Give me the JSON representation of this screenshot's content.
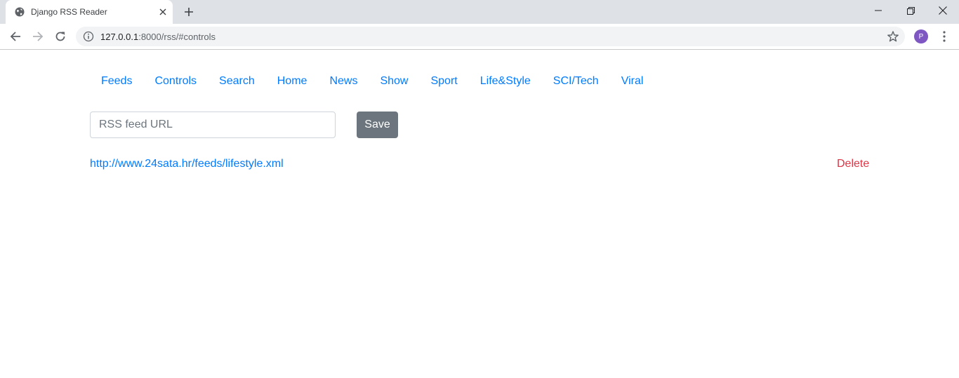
{
  "browser": {
    "tab_title": "Django RSS Reader",
    "url_host": "127.0.0.1",
    "url_path": ":8000/rss/#controls",
    "profile_initial": "P"
  },
  "nav": {
    "items": [
      {
        "label": "Feeds"
      },
      {
        "label": "Controls"
      },
      {
        "label": "Search"
      },
      {
        "label": "Home"
      },
      {
        "label": "News"
      },
      {
        "label": "Show"
      },
      {
        "label": "Sport"
      },
      {
        "label": "Life&Style"
      },
      {
        "label": "SCI/Tech"
      },
      {
        "label": "Viral"
      }
    ]
  },
  "form": {
    "url_placeholder": "RSS feed URL",
    "url_value": "",
    "save_label": "Save"
  },
  "feeds": [
    {
      "url": "http://www.24sata.hr/feeds/lifestyle.xml",
      "delete_label": "Delete"
    }
  ],
  "colors": {
    "link": "#007bff",
    "danger": "#dc3545",
    "secondary_button": "#6c757d",
    "avatar": "#7e57c2"
  }
}
